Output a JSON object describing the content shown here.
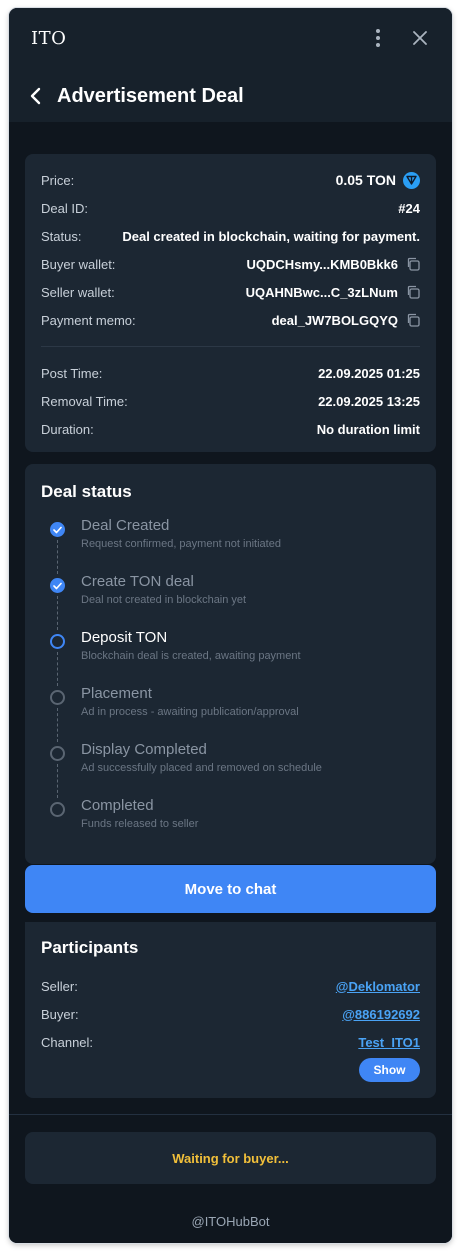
{
  "window": {
    "app_title": "ITO"
  },
  "header": {
    "title": "Advertisement Deal"
  },
  "deal": {
    "price_label": "Price:",
    "price_value": "0.05 TON",
    "id_label": "Deal ID:",
    "id_value": "#24",
    "status_label": "Status:",
    "status_value": "Deal created in blockchain, waiting for payment.",
    "buyer_wallet_label": "Buyer wallet:",
    "buyer_wallet_value": "UQDCHsmy...KMB0Bkk6",
    "seller_wallet_label": "Seller wallet:",
    "seller_wallet_value": "UQAHNBwc...C_3zLNum",
    "memo_label": "Payment memo:",
    "memo_value": "deal_JW7BOLGQYQ",
    "post_time_label": "Post Time:",
    "post_time_value": "22.09.2025 01:25",
    "removal_time_label": "Removal Time:",
    "removal_time_value": "22.09.2025 13:25",
    "duration_label": "Duration:",
    "duration_value": "No duration limit"
  },
  "deal_status": {
    "title": "Deal status",
    "steps": [
      {
        "title": "Deal Created",
        "subtitle": "Request confirmed, payment not initiated",
        "state": "done"
      },
      {
        "title": "Create TON deal",
        "subtitle": "Deal not created in blockchain yet",
        "state": "done"
      },
      {
        "title": "Deposit TON",
        "subtitle": "Blockchain deal is created, awaiting payment",
        "state": "active"
      },
      {
        "title": "Placement",
        "subtitle": "Ad in process - awaiting publication/approval",
        "state": "pending"
      },
      {
        "title": "Display Completed",
        "subtitle": "Ad successfully placed and removed on schedule",
        "state": "pending"
      },
      {
        "title": "Completed",
        "subtitle": "Funds released to seller",
        "state": "pending"
      }
    ]
  },
  "actions": {
    "move_to_chat": "Move to chat"
  },
  "participants": {
    "title": "Participants",
    "seller_label": "Seller:",
    "seller_value": "@Deklomator",
    "buyer_label": "Buyer:",
    "buyer_value": "@886192692",
    "channel_label": "Channel:",
    "channel_value": "Test_ITO1",
    "show_label": "Show"
  },
  "waiting_text": "Waiting for buyer...",
  "footer": "@ITOHubBot",
  "colors": {
    "accent": "#3f86f5",
    "background": "#17212b",
    "card": "#1c2733",
    "warning": "#f2c03a",
    "link": "#4aa3f5"
  },
  "icons": [
    "more-vertical-icon",
    "close-icon",
    "back-arrow-icon",
    "ton-icon",
    "copy-icon",
    "check-icon"
  ]
}
